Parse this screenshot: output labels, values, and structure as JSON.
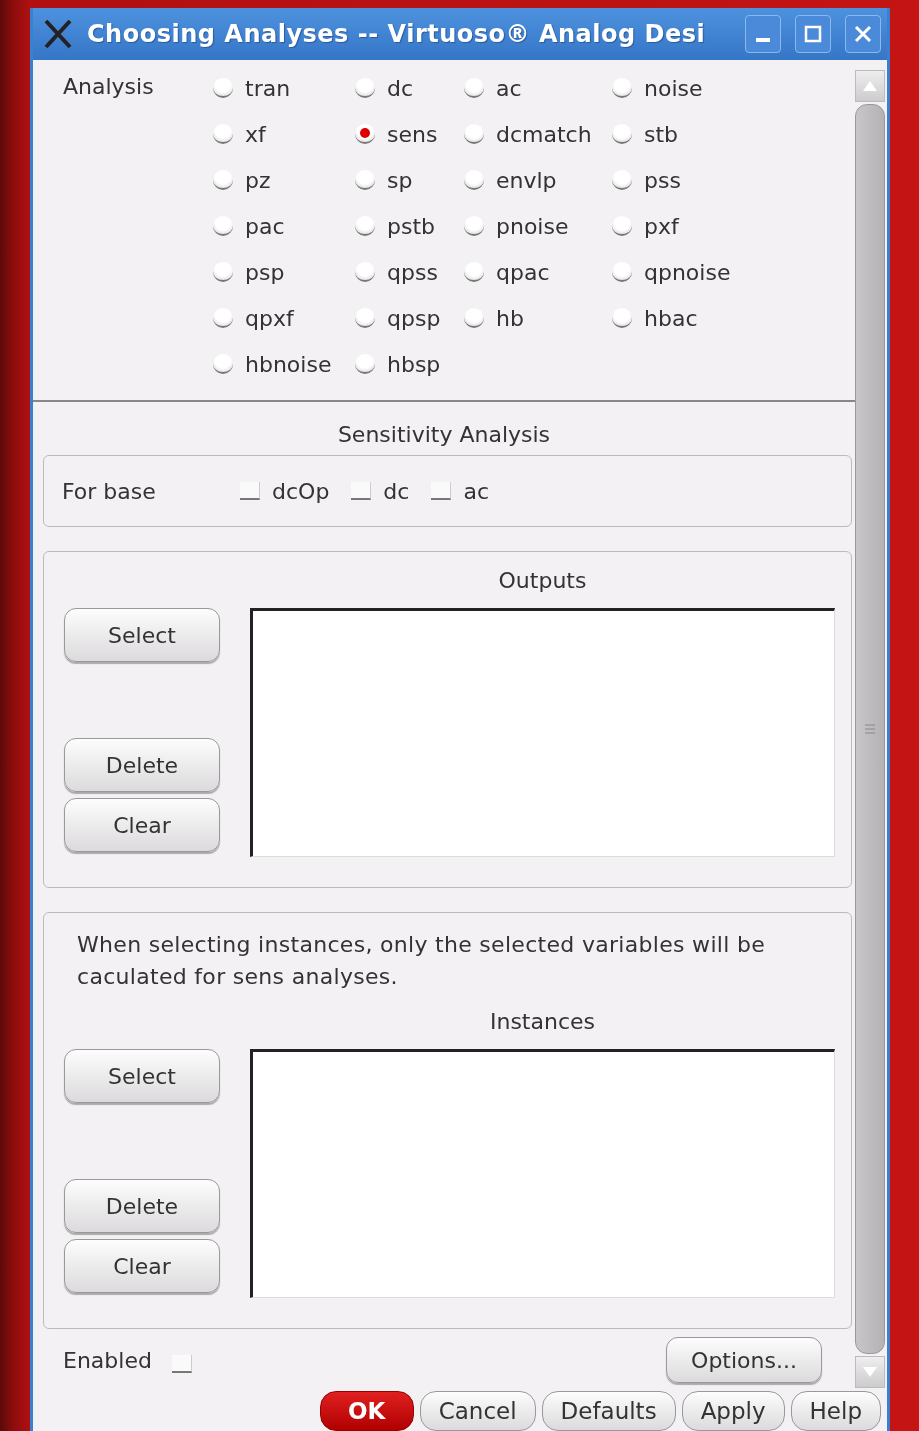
{
  "window": {
    "title": "Choosing Analyses -- Virtuoso® Analog Desi"
  },
  "analysis": {
    "label": "Analysis",
    "options": [
      {
        "label": "tran",
        "selected": false
      },
      {
        "label": "dc",
        "selected": false
      },
      {
        "label": "ac",
        "selected": false
      },
      {
        "label": "noise",
        "selected": false
      },
      {
        "label": "xf",
        "selected": false
      },
      {
        "label": "sens",
        "selected": true
      },
      {
        "label": "dcmatch",
        "selected": false
      },
      {
        "label": "stb",
        "selected": false
      },
      {
        "label": "pz",
        "selected": false
      },
      {
        "label": "sp",
        "selected": false
      },
      {
        "label": "envlp",
        "selected": false
      },
      {
        "label": "pss",
        "selected": false
      },
      {
        "label": "pac",
        "selected": false
      },
      {
        "label": "pstb",
        "selected": false
      },
      {
        "label": "pnoise",
        "selected": false
      },
      {
        "label": "pxf",
        "selected": false
      },
      {
        "label": "psp",
        "selected": false
      },
      {
        "label": "qpss",
        "selected": false
      },
      {
        "label": "qpac",
        "selected": false
      },
      {
        "label": "qpnoise",
        "selected": false
      },
      {
        "label": "qpxf",
        "selected": false
      },
      {
        "label": "qpsp",
        "selected": false
      },
      {
        "label": "hb",
        "selected": false
      },
      {
        "label": "hbac",
        "selected": false
      },
      {
        "label": "hbnoise",
        "selected": false
      },
      {
        "label": "hbsp",
        "selected": false
      }
    ]
  },
  "section_title": "Sensitivity Analysis",
  "for_base": {
    "label": "For base",
    "options": [
      {
        "label": "dcOp",
        "checked": false
      },
      {
        "label": "dc",
        "checked": false
      },
      {
        "label": "ac",
        "checked": false
      }
    ]
  },
  "outputs": {
    "title": "Outputs",
    "buttons": [
      "Select",
      "Delete",
      "Clear"
    ]
  },
  "instances": {
    "note": "When selecting instances, only the selected variables will be caculated for sens analyses.",
    "title": "Instances",
    "buttons": [
      "Select",
      "Delete",
      "Clear"
    ]
  },
  "enabled": {
    "label": "Enabled",
    "checked": false
  },
  "options_button": "Options...",
  "dialog_buttons": [
    {
      "label": "OK",
      "kind": "default"
    },
    {
      "label": "Cancel",
      "kind": "normal"
    },
    {
      "label": "Defaults",
      "kind": "normal"
    },
    {
      "label": "Apply",
      "kind": "normal"
    },
    {
      "label": "Help",
      "kind": "normal"
    }
  ]
}
